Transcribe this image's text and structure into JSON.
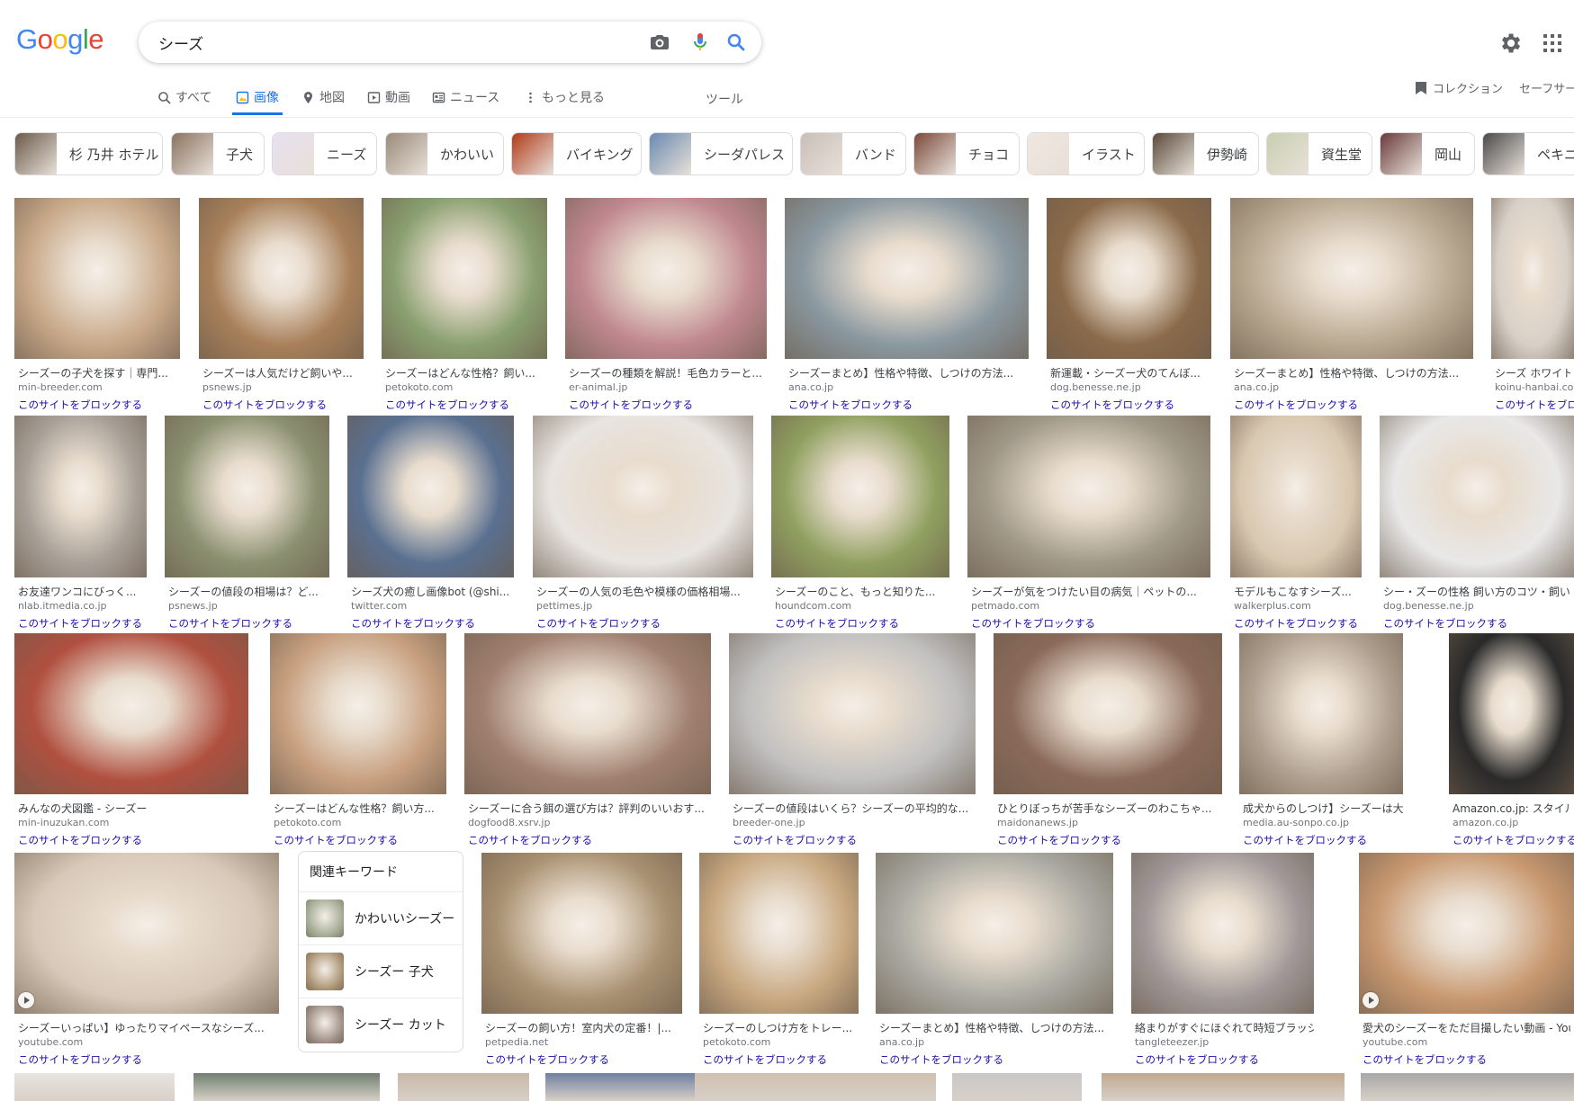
{
  "header": {
    "logo_letters": [
      {
        "ch": "G",
        "color": "#4285F4"
      },
      {
        "ch": "o",
        "color": "#EA4335"
      },
      {
        "ch": "o",
        "color": "#FBBC05"
      },
      {
        "ch": "g",
        "color": "#4285F4"
      },
      {
        "ch": "l",
        "color": "#34A853"
      },
      {
        "ch": "e",
        "color": "#EA4335"
      }
    ],
    "search_value": "シーズ"
  },
  "tabs": [
    {
      "label": "すべて",
      "icon": "search-icon",
      "active": false
    },
    {
      "label": "画像",
      "icon": "image-icon",
      "active": true
    },
    {
      "label": "地図",
      "icon": "map-pin-icon",
      "active": false
    },
    {
      "label": "動画",
      "icon": "video-icon",
      "active": false
    },
    {
      "label": "ニュース",
      "icon": "news-icon",
      "active": false
    },
    {
      "label": "もっと見る",
      "icon": "more-vert-icon",
      "active": false
    }
  ],
  "tools_label": "ツール",
  "collection_label": "コレクション",
  "safesearch_label": "セーフサー",
  "chips": [
    {
      "label": "杉 乃井 ホテル",
      "color": "#6b5a4a"
    },
    {
      "label": "子犬",
      "color": "#8a7260"
    },
    {
      "label": "ニーズ",
      "color": "#e8e0f0"
    },
    {
      "label": "かわいい",
      "color": "#9a8a7a"
    },
    {
      "label": "バイキング",
      "color": "#b03a1a"
    },
    {
      "label": "シーダパレス",
      "color": "#6a8ab0"
    },
    {
      "label": "バンド",
      "color": "#c8c0b8"
    },
    {
      "label": "チョコ",
      "color": "#7a4a3a"
    },
    {
      "label": "イラスト",
      "color": "#f0e8e0"
    },
    {
      "label": "伊勢崎",
      "color": "#5a4a3a"
    },
    {
      "label": "資生堂",
      "color": "#c8d0b0"
    },
    {
      "label": "岡山",
      "color": "#6a3a3a"
    },
    {
      "label": "ペキニ",
      "color": "#4a4a4a"
    }
  ],
  "block_label": "このサイトをブロックする",
  "rows": [
    [
      {
        "title": "シーズーの子犬を探す｜専門...",
        "domain": "min-breeder.com",
        "color": "#c8a888"
      },
      {
        "title": "シーズーは人気だけど飼いや...",
        "domain": "psnews.jp",
        "color": "#a8805a"
      },
      {
        "title": "シーズーはどんな性格？飼い...",
        "domain": "petokoto.com",
        "color": "#8aa070"
      },
      {
        "title": "シーズーの種類を解説！毛色カラーと...",
        "domain": "er-animal.jp",
        "color": "#c08890"
      },
      {
        "title": "シーズーまとめ】性格や特徴、しつけの方法...",
        "domain": "ana.co.jp",
        "color": "#8a98a0"
      },
      {
        "title": "新運載・シーズー犬のてんぼ...",
        "domain": "dog.benesse.ne.jp",
        "color": "#8a6a4a"
      },
      {
        "title": "シーズーまとめ】性格や特徴、しつけの方法...",
        "domain": "ana.co.jp",
        "color": "#b8a890"
      },
      {
        "title": "シーズ ホワイト",
        "domain": "koinu-hanbai.com",
        "color": "#d8d0c8"
      }
    ],
    [
      {
        "title": "お友達ワンコにびっく...",
        "domain": "nlab.itmedia.co.jp",
        "color": "#a8a098"
      },
      {
        "title": "シーズーの値段の相場は？ど...",
        "domain": "psnews.jp",
        "color": "#8a9070"
      },
      {
        "title": "シーズ犬の癒し画像bot (@shi...",
        "domain": "twitter.com",
        "color": "#5a7090"
      },
      {
        "title": "シーズーの人気の毛色や模様の価格相場...",
        "domain": "pettimes.jp",
        "color": "#e8e4e0"
      },
      {
        "title": "シーズーのこと、もっと知りた...",
        "domain": "houndcom.com",
        "color": "#90a060"
      },
      {
        "title": "シーズーが気をつけたい目の病気｜ペットの...",
        "domain": "petmado.com",
        "color": "#a09888"
      },
      {
        "title": "モデルもこなすシーズ...",
        "domain": "walkerplus.com",
        "color": "#d8c8b0"
      },
      {
        "title": "シー・ズーの性格 飼い方のコツ・飼い",
        "domain": "dog.benesse.ne.jp",
        "color": "#e8e8e8"
      }
    ],
    [
      {
        "title": "みんなの犬図鑑 - シーズー",
        "domain": "min-inuzukan.com",
        "color": "#b05040"
      },
      {
        "title": "シーズーはどんな性格？飼い方...",
        "domain": "petokoto.com",
        "color": "#c8a080"
      },
      {
        "title": "シーズーに合う餌の選び方は？評判のいいおす...",
        "domain": "dogfood8.xsrv.jp",
        "color": "#a08070"
      },
      {
        "title": "シーズーの値段はいくら？シーズーの平均的な...",
        "domain": "breeder-one.jp",
        "color": "#c0c0c0"
      },
      {
        "title": "ひとりぼっちが苦手なシーズーのわこちゃ...",
        "domain": "maidonanews.jp",
        "color": "#8a6a5a"
      },
      {
        "title": "成犬からのしつけ】シーズーは大人...",
        "domain": "media.au-sonpo.co.jp",
        "color": "#b0a090"
      },
      {
        "title": "Amazon.co.jp: スタイルズ",
        "domain": "amazon.co.jp",
        "color": "#2a2a2a"
      }
    ],
    [
      {
        "title": "シーズーいっぱい】ゆったりマイペースなシーズ...",
        "domain": "youtube.com",
        "color": "#d8c8b8",
        "video": true
      },
      {
        "title": "シーズーの飼い方！室内犬の定番！|...",
        "domain": "petpedia.net",
        "color": "#a89070"
      },
      {
        "title": "シーズーのしつけ方をトレー...",
        "domain": "petokoto.com",
        "color": "#c8a880"
      },
      {
        "title": "シーズーまとめ】性格や特徴、しつけの方法...",
        "domain": "ana.co.jp",
        "color": "#a8a8a0"
      },
      {
        "title": "絡まりがすぐにほぐれて時短ブラッシ...",
        "domain": "tangleteezer.jp",
        "color": "#a09898"
      },
      {
        "title": "愛犬のシーズーをただ目撮したい動画 - You",
        "domain": "youtube.com",
        "color": "#c89870",
        "video": true
      }
    ]
  ],
  "related": {
    "title": "関連キーワード",
    "items": [
      {
        "label": "かわいいシーズー",
        "color": "#a0a890"
      },
      {
        "label": "シーズー 子犬",
        "color": "#a89070"
      },
      {
        "label": "シーズー カット",
        "color": "#9a8a80"
      }
    ]
  },
  "bottom_strip": [
    "#e8e4e0",
    "#708070",
    "#c8b8a8",
    "#7080a0",
    "#d0c0b0",
    "#c8c8c8",
    "#c0a890",
    "#a8a8a8"
  ]
}
